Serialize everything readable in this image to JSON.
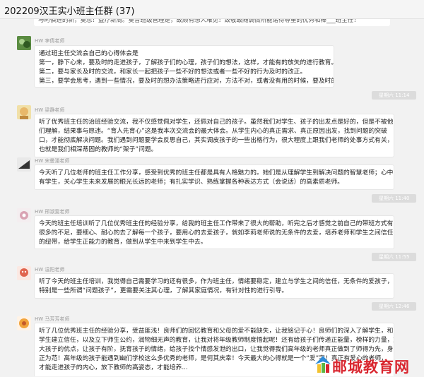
{
  "window": {
    "title": "202209汉王实小班主任群 (37)"
  },
  "top_message": {
    "text": "与时俱进的新，莫忽！益疗新周。莫音班级管理是，故顾有想人难见！致敬敢随调情所能诸待尊重的优秀和棒___班主任！"
  },
  "messages": [
    {
      "sender": "HW 李倩老师",
      "lines": [
        "通过班主任交流会自己的心得体会是",
        "第一，静下心来，要及时的走进孩子，了解孩子们的心理，孩子们的想法，这样，才能有的放矢的进行教育。",
        "第二，要与家长及时的交流，和家长一起把孩子一些不好的想法或者一些不好的行为及时的改正。",
        "第三，要学会思考，遇到一些情况，要及时的想办法策略进行应对，方法不对，或者没有用的时候，要及时的调整。"
      ],
      "time": "星期六 11:14"
    },
    {
      "sender": "HW 梁静老师",
      "lines": [
        "听了优秀班主任的治班经验交流，我不仅感觉佩对学生，还佩对自己的孩子。虽然我们对学生、孩子的出发点是好的，但是不被他",
        "们理解，结果事与愿违。“育人先育心”这是我本次交流会的最大体会。从学生内心的真正需求、真正原因出发，找到问题的突破",
        "口，才能彻底解决问题。我们遇到问题要学会反思自己，其实调皮孩子的一些出格行为，很大程度上跟我们老师的处事方式有关，",
        "也就是我们相深蒂固的教师的“架子”问题。"
      ],
      "time": ""
    },
    {
      "sender": "HW 宋曼潘老师",
      "lines": [
        "今天听了几位老师的班主任工作分享，感受到优秀的班主任都是具有人格魅力的。她们是从理解学生到解决问题的智慧老师；心中",
        "有学生，关心学生未来发展的眼光长远的老师；有扎实学识、熟练掌握各种表达方式（会说话）的高素质老师。"
      ],
      "time": "星期六 11:40"
    },
    {
      "sender": "HW 邢淑雯老师",
      "lines": [
        "今天的班主任培训听了几位优秀班主任的经验分享，给我的班主任工作带来了很大的帮助，听完之后才感觉之前自己的带班方式有",
        "很多的不足，要细心、耐心的去了解每一个孩子，要用心的去爱孩子，就如李莉老师说的无条件的去爱，培养老师和学生之间信任",
        "的纽带，给学生正能力的教育，做到从学生中来到学生中去。"
      ],
      "time": "星期六 11:55"
    },
    {
      "sender": "HW 温阳老师",
      "lines": [
        "听了今天的班主任培训，我觉得自己需要学习的还有很多，作为班主任，情绪要稳定，建立与学生之间的信任，无条件的爱孩子，",
        "特别是一些所谓“问题孩子”，更需要关注其心理，了解其家庭情况，有针对性的进行引导。"
      ],
      "time": "星期六 12:46"
    },
    {
      "sender": "HW 马芳芳老师",
      "lines": [
        "听了几位优秀班主任的经验分享，受益匪浅！良师们的回忆教育和父母的爱不能缺失，让我铭记于心！良师们的深入了解学生，和",
        "学生建立信任，以及立下师生公约，润物细无声的教育，让我对将年级教师制度悟起呢！还有给孩子们传递正能量，榜样的力量，放",
        "大孩子的优点，让孩子有阶，抚育孩子的情绪，给孩子找个情感发泄的出口，让我觉得我们高年级的老师真正做到了师得为先，身",
        "正为范！高年级的孩子能遇到幽们学校这么多优秀的老师，是何其庆幸！今天最大的心得就是一个“爱”字！真正有爱心的老师，",
        "才能走进孩子的内心，放下教师的高姿态，才能培养..."
      ],
      "time": ""
    }
  ],
  "watermark": {
    "text": "邮城教育网"
  },
  "colors": {
    "window_bg": "#f2f2f2",
    "bubble": "#ffffff",
    "time_stamp": "#dcdcdc",
    "watermark": "#d9262f"
  }
}
